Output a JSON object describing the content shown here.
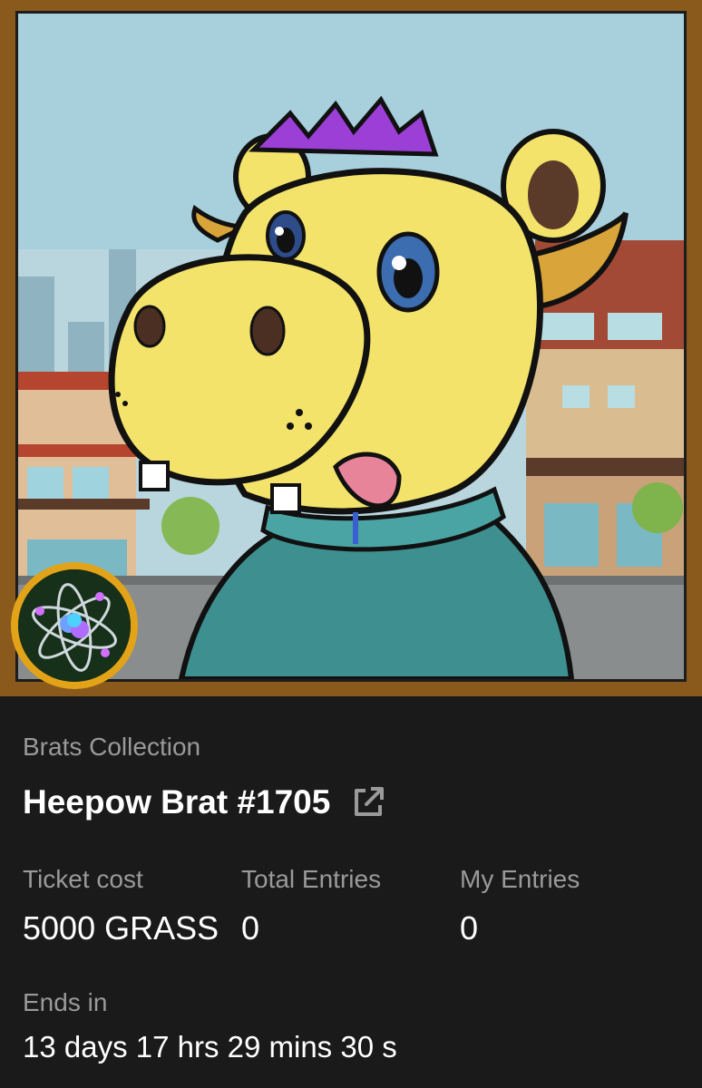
{
  "collection_name": "Brats Collection",
  "nft_title": "Heepow Brat #1705",
  "stats": [
    {
      "label": "Ticket cost",
      "value": "5000 GRASS"
    },
    {
      "label": "Total Entries",
      "value": "0"
    },
    {
      "label": "My Entries",
      "value": "0"
    }
  ],
  "ends_in_label": "Ends in",
  "countdown": "13 days 17 hrs 29 mins 30 s",
  "icons": {
    "external_link": "external-link-icon",
    "collection_badge": "atom-icon"
  },
  "colors": {
    "frame": "#8a5a1c",
    "background": "#1a1a1a",
    "label": "#9a9a9a",
    "badge_ring": "#e2a319"
  }
}
